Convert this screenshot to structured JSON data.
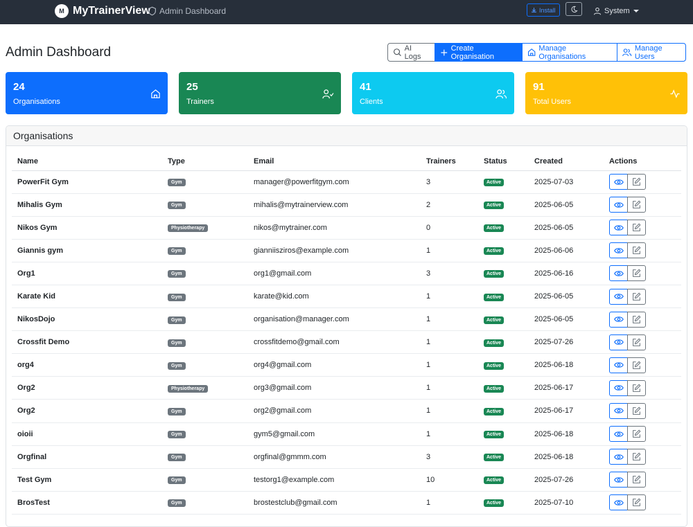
{
  "nav": {
    "brand_initial": "M",
    "brand_name": "MyTrainerView",
    "page_link": "Admin Dashboard",
    "install_label": "Install",
    "user_label": "System"
  },
  "header": {
    "title": "Admin Dashboard",
    "ai_logs_label": "AI Logs",
    "create_org_label": "Create Organisation",
    "manage_orgs_label": "Manage Organisations",
    "manage_users_label": "Manage Users"
  },
  "stats": [
    {
      "value": "24",
      "label": "Organisations",
      "icon": "home-icon",
      "color": "#0d6efd"
    },
    {
      "value": "25",
      "label": "Trainers",
      "icon": "user-check-icon",
      "color": "#198754"
    },
    {
      "value": "41",
      "label": "Clients",
      "icon": "users-icon",
      "color": "#0dcaf0"
    },
    {
      "value": "91",
      "label": "Total Users",
      "icon": "activity-icon",
      "color": "#ffc107"
    }
  ],
  "organisations": {
    "title": "Organisations",
    "columns": [
      "Name",
      "Type",
      "Email",
      "Trainers",
      "Status",
      "Created",
      "Actions"
    ],
    "rows": [
      {
        "name": "PowerFit Gym",
        "type": "Gym",
        "email": "manager@powerfitgym.com",
        "trainers": "3",
        "status": "Active",
        "created": "2025-07-03"
      },
      {
        "name": "Mihalis Gym",
        "type": "Gym",
        "email": "mihalis@mytrainerview.com",
        "trainers": "2",
        "status": "Active",
        "created": "2025-06-05"
      },
      {
        "name": "Nikos Gym",
        "type": "Physiotherapy",
        "email": "nikos@mytrainer.com",
        "trainers": "0",
        "status": "Active",
        "created": "2025-06-05"
      },
      {
        "name": "Giannis gym",
        "type": "Gym",
        "email": "gianniisziros@example.com",
        "trainers": "1",
        "status": "Active",
        "created": "2025-06-06"
      },
      {
        "name": "Org1",
        "type": "Gym",
        "email": "org1@gmail.com",
        "trainers": "3",
        "status": "Active",
        "created": "2025-06-16"
      },
      {
        "name": "Karate Kid",
        "type": "Gym",
        "email": "karate@kid.com",
        "trainers": "1",
        "status": "Active",
        "created": "2025-06-05"
      },
      {
        "name": "NikosDojo",
        "type": "Gym",
        "email": "organisation@manager.com",
        "trainers": "1",
        "status": "Active",
        "created": "2025-06-05"
      },
      {
        "name": "Crossfit Demo",
        "type": "Gym",
        "email": "crossfitdemo@gmail.com",
        "trainers": "1",
        "status": "Active",
        "created": "2025-07-26"
      },
      {
        "name": "org4",
        "type": "Gym",
        "email": "org4@gmail.com",
        "trainers": "1",
        "status": "Active",
        "created": "2025-06-18"
      },
      {
        "name": "Org2",
        "type": "Physiotherapy",
        "email": "org3@gmail.com",
        "trainers": "1",
        "status": "Active",
        "created": "2025-06-17"
      },
      {
        "name": "Org2",
        "type": "Gym",
        "email": "org2@gmail.com",
        "trainers": "1",
        "status": "Active",
        "created": "2025-06-17"
      },
      {
        "name": "oioii",
        "type": "Gym",
        "email": "gym5@gmail.com",
        "trainers": "1",
        "status": "Active",
        "created": "2025-06-18"
      },
      {
        "name": "Orgfinal",
        "type": "Gym",
        "email": "orgfinal@gmmm.com",
        "trainers": "3",
        "status": "Active",
        "created": "2025-06-18"
      },
      {
        "name": "Test Gym",
        "type": "Gym",
        "email": "testorg1@example.com",
        "trainers": "10",
        "status": "Active",
        "created": "2025-07-26"
      },
      {
        "name": "BrosTest",
        "type": "Gym",
        "email": "brostestclub@gmail.com",
        "trainers": "1",
        "status": "Active",
        "created": "2025-07-10"
      }
    ]
  }
}
